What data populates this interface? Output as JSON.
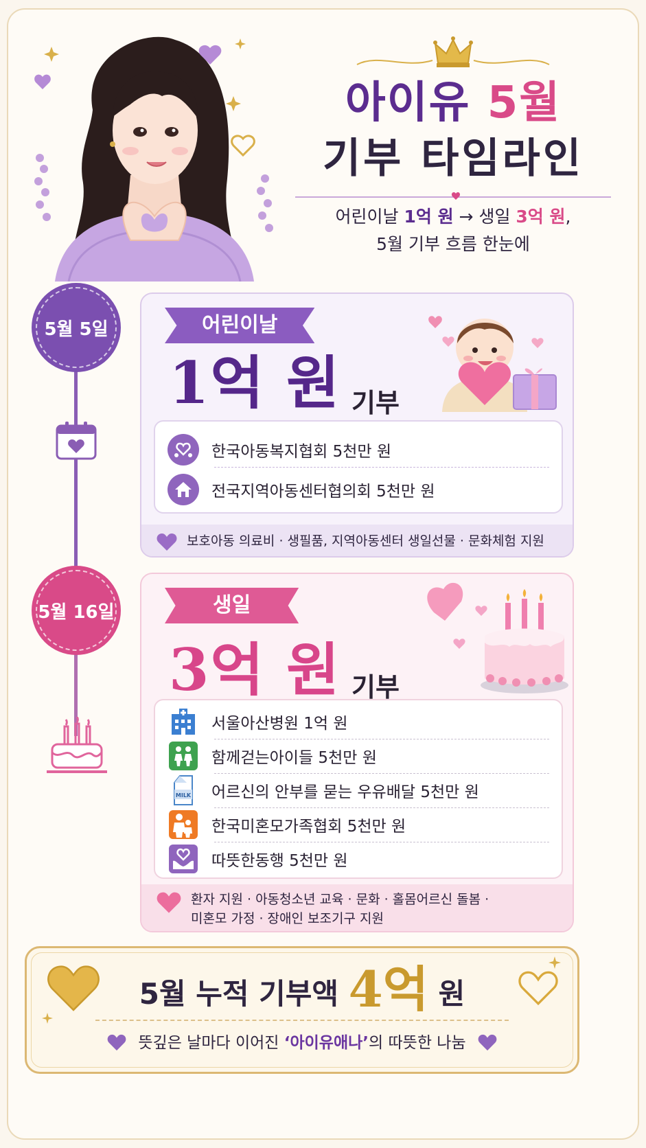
{
  "header": {
    "title_name": "아이유",
    "title_month": "5월",
    "title_line2": "기부 타임라인",
    "subtitle_a": "어린이날",
    "subtitle_b": "1억 원",
    "subtitle_c": "→ 생일",
    "subtitle_d": "3억 원",
    "subtitle_e": ",",
    "subtitle_line2": "5월 기부 흐름 한눈에"
  },
  "timeline": [
    {
      "date": "5월 5일",
      "ribbon": "어린이날",
      "amount": "1억 원",
      "suffix": "기부",
      "items": [
        {
          "icon": "children-heart-icon",
          "text": "한국아동복지협회 5천만 원"
        },
        {
          "icon": "house-icon",
          "text": "전국지역아동센터협의회 5천만 원"
        }
      ],
      "note": "보호아동 의료비 · 생필품, 지역아동센터 생일선물 · 문화체험 지원"
    },
    {
      "date": "5월 16일",
      "ribbon": "생일",
      "amount": "3억 원",
      "suffix": "기부",
      "items": [
        {
          "icon": "hospital-icon",
          "text": "서울아산병원 1억 원"
        },
        {
          "icon": "walking-children-icon",
          "text": "함께걷는아이들 5천만 원"
        },
        {
          "icon": "milk-carton-icon",
          "text": "어르신의 안부를 묻는 우유배달 5천만 원"
        },
        {
          "icon": "family-icon",
          "text": "한국미혼모가족협회 5천만 원"
        },
        {
          "icon": "hands-heart-icon",
          "text": "따뜻한동행 5천만 원"
        }
      ],
      "note_line1": "환자 지원 · 아동청소년 교육 · 문화 · 홀몸어르신 돌봄 ·",
      "note_line2": "미혼모 가정 · 장애인 보조기구 지원"
    }
  ],
  "total": {
    "prefix": "5월 누적 기부액",
    "amount": "4억",
    "unit": "원",
    "sub_a": "뜻깊은 날마다 이어진",
    "sub_quote": "‘아이유애나’",
    "sub_b": "의 따뜻한 나눔",
    "milk_label": "MILK"
  },
  "colors": {
    "purple": "#5b2c8f",
    "pink": "#d94a88",
    "gold": "#c99a2e",
    "background": "#fbf6ee"
  }
}
